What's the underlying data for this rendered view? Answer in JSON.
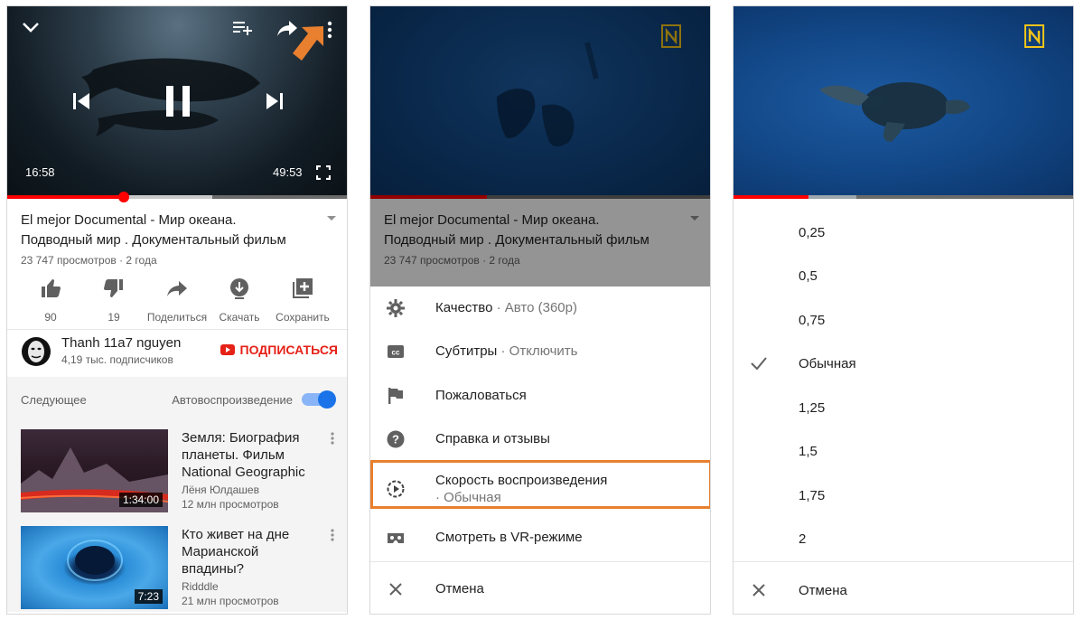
{
  "colors": {
    "brand_red": "#ff0000",
    "subscribe_red": "#e62117",
    "toggle_blue": "#1a73e8",
    "highlight_orange": "#e8802f"
  },
  "player1": {
    "current_time": "16:58",
    "total_time": "49:53",
    "progress": 0.34,
    "icons": [
      "chevron-down-icon",
      "add-to-playlist-icon",
      "share-icon",
      "more-vert-icon",
      "previous-icon",
      "pause-icon",
      "next-icon",
      "fullscreen-icon"
    ]
  },
  "video": {
    "title_line1": "El mejor Documental - Мир океана.",
    "title_line2": "Подводный мир . Документальный фильм",
    "views_meta": "23 747 просмотров · 2 года"
  },
  "actions": [
    {
      "icon": "thumb-up-icon",
      "label": "90"
    },
    {
      "icon": "thumb-down-icon",
      "label": "19"
    },
    {
      "icon": "share-icon",
      "label": "Поделиться"
    },
    {
      "icon": "download-icon",
      "label": "Скачать"
    },
    {
      "icon": "add-to-playlist-icon",
      "label": "Сохранить"
    }
  ],
  "channel": {
    "name": "Thanh 11a7 nguyen",
    "subscribers": "4,19 тыс. подписчиков",
    "subscribe_label": "ПОДПИСАТЬСЯ"
  },
  "up_next": {
    "label": "Следующее",
    "autoplay_label": "Автовоспроизведение",
    "autoplay_on": true,
    "items": [
      {
        "title_lines": [
          "Земля: Биография",
          "планеты. Фильм",
          "National Geographic"
        ],
        "author": "Лёня Юлдашев",
        "views": "12 млн просмотров",
        "duration": "1:34:00"
      },
      {
        "title_lines": [
          "Кто живет на дне",
          "Марианской",
          "впадины?"
        ],
        "author": "Ridddle",
        "views": "21 млн просмотров",
        "duration": "7:23"
      }
    ]
  },
  "menu": {
    "items": [
      {
        "icon": "gear-icon",
        "label": "Качество",
        "sub": " · Авто (360p)"
      },
      {
        "icon": "cc-icon",
        "label": "Субтитры",
        "sub": " · Отключить"
      },
      {
        "icon": "flag-icon",
        "label": "Пожаловаться",
        "sub": ""
      },
      {
        "icon": "help-icon",
        "label": "Справка и отзывы",
        "sub": ""
      },
      {
        "icon": "playback-speed-icon",
        "label": "Скорость воспроизведения",
        "sub": "· Обычная"
      },
      {
        "icon": "vr-icon",
        "label": "Смотреть в VR-режиме",
        "sub": ""
      },
      {
        "icon": "close-icon",
        "label": "Отмена",
        "sub": ""
      }
    ]
  },
  "speed": {
    "options": [
      "0,25",
      "0,5",
      "0,75",
      "Обычная",
      "1,25",
      "1,5",
      "1,75",
      "2"
    ],
    "selected_index": 3,
    "cancel_label": "Отмена"
  }
}
